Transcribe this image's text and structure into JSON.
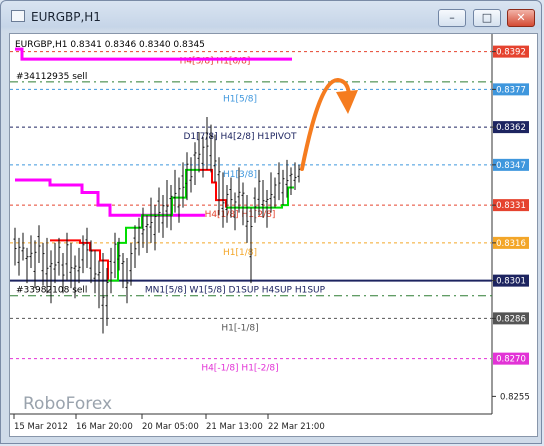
{
  "window": {
    "title": "EURGBP,H1"
  },
  "buttons": {
    "minimize": "–",
    "maximize": "□",
    "close": "✕"
  },
  "chart_info": {
    "symbol_tf": "EURGBP,H1",
    "ohlc": "0.8341 0.8346 0.8340 0.8345",
    "order1": "#34112935 sell",
    "order2": "#33982108 sell"
  },
  "watermark": "RoboForex",
  "chart_data": {
    "type": "line",
    "y_axis": {
      "ylim": [
        0.8248,
        0.8399
      ],
      "ticks": [
        0.8255,
        0.8286,
        0.8301,
        0.8316,
        0.8331,
        0.8347,
        0.8362,
        0.8377,
        0.8392
      ]
    },
    "x_axis": {
      "ticks": [
        "15 Mar 2012",
        "16 Mar 20:00",
        "20 Mar 05:00",
        "21 Mar 13:00",
        "22 Mar 21:00"
      ]
    },
    "price_tags": [
      {
        "value": "0.8392",
        "color": "#e5432f"
      },
      {
        "value": "0.8377",
        "color": "#3f97dd"
      },
      {
        "value": "0.8362",
        "color": "#1d2460"
      },
      {
        "value": "0.8347",
        "color": "#3f97dd"
      },
      {
        "value": "0.8331",
        "color": "#e5432f"
      },
      {
        "value": "0.8316",
        "color": "#f3a628"
      },
      {
        "value": "0.8301",
        "color": "#1d2460"
      },
      {
        "value": "0.8286",
        "color": "#555555"
      },
      {
        "value": "0.8270",
        "color": "#e233d6"
      }
    ],
    "levels": [
      {
        "price": 0.8392,
        "label": "H4[3/8] H1[6/8]",
        "color": "#e5432f"
      },
      {
        "price": 0.8377,
        "label": "H1[5/8]",
        "color": "#3f97dd"
      },
      {
        "price": 0.8362,
        "label": "D1[7/8] H4[2/8] H1PIVOT",
        "color": "#1d2460"
      },
      {
        "price": 0.8347,
        "label": "H1[3/8]",
        "color": "#3f97dd"
      },
      {
        "price": 0.8331,
        "label": "H4[1/8] H1[2/8]",
        "color": "#e5432f"
      },
      {
        "price": 0.8316,
        "label": "H1[1/8]",
        "color": "#f3a628"
      },
      {
        "price": 0.8301,
        "label": "MN1[5/8] W1[5/8] D1SUP H4SUP H1SUP",
        "color": "#1d2460"
      },
      {
        "price": 0.8286,
        "label": "H1[-1/8]",
        "color": "#555555"
      },
      {
        "price": 0.827,
        "label": "H4[-1/8] H1[-2/8]",
        "color": "#e233d6"
      }
    ],
    "order_lines": [
      {
        "price": 0.838,
        "label": "#34112935 sell",
        "color": "#2e7d32"
      },
      {
        "price": 0.8295,
        "label": "#33982108 sell",
        "color": "#2e7d32"
      }
    ],
    "colors": {
      "bars": "#111111",
      "green_trail": "#00dd00",
      "red_trail": "#ff0000",
      "magenta_trail": "#ff00ff",
      "forecast_arrow": "#f57c1f"
    }
  }
}
